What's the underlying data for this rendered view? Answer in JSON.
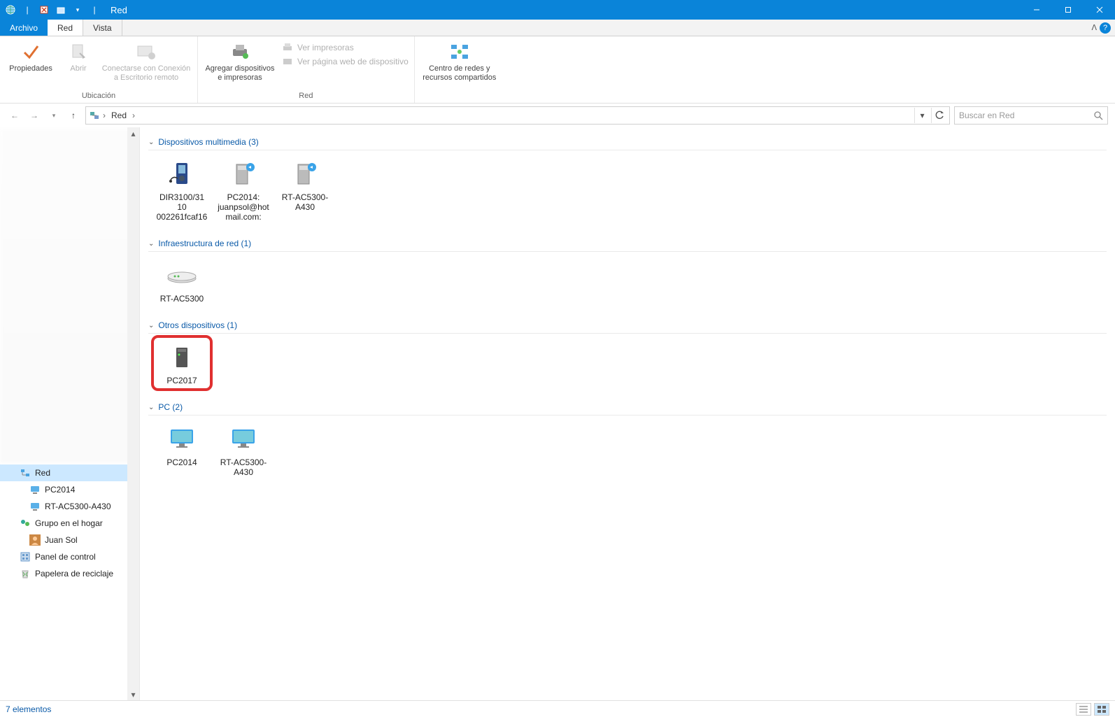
{
  "window": {
    "title": "Red"
  },
  "tabs": {
    "file": "Archivo",
    "red": "Red",
    "vista": "Vista"
  },
  "ribbon": {
    "propiedades": "Propiedades",
    "abrir": "Abrir",
    "conectar": "Conectarse con Conexión a Escritorio remoto",
    "ubicacion_group": "Ubicación",
    "agregar": "Agregar dispositivos e impresoras",
    "ver_impresoras": "Ver impresoras",
    "ver_web": "Ver página web de dispositivo",
    "red_group": "Red",
    "centro": "Centro de redes y recursos compartidos"
  },
  "address": {
    "crumb1": "Red"
  },
  "search": {
    "placeholder": "Buscar en Red"
  },
  "nav": {
    "red": "Red",
    "pc2014": "PC2014",
    "rtac": "RT-AC5300-A430",
    "grupo": "Grupo en el hogar",
    "juan": "Juan Sol",
    "panel": "Panel de control",
    "papelera": "Papelera de reciclaje"
  },
  "groups": {
    "multimedia": {
      "title": "Dispositivos multimedia (3)",
      "items": [
        {
          "label": "DIR3100/31 10 002261fcaf16"
        },
        {
          "label": "PC2014: juanpsol@hotmail.com:"
        },
        {
          "label": "RT-AC5300-A430"
        }
      ]
    },
    "infraestructura": {
      "title": "Infraestructura de red (1)",
      "items": [
        {
          "label": "RT-AC5300"
        }
      ]
    },
    "otros": {
      "title": "Otros dispositivos (1)",
      "items": [
        {
          "label": "PC2017"
        }
      ]
    },
    "pc": {
      "title": "PC (2)",
      "items": [
        {
          "label": "PC2014"
        },
        {
          "label": "RT-AC5300-A430"
        }
      ]
    }
  },
  "status": {
    "count": "7 elementos"
  }
}
